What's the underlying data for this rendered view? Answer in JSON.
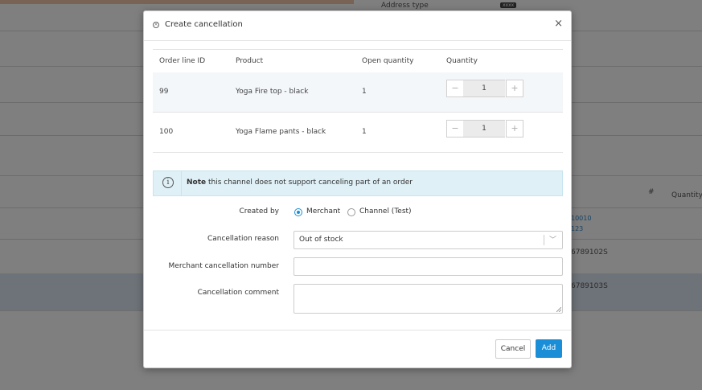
{
  "background": {
    "address_type_label": "Address type",
    "address_type_badge": "xxxx",
    "hash_header": "#",
    "quantity_header": "Quantity",
    "row1_link_a": "10010",
    "row1_link_b": "123",
    "row2_id": "6789102S",
    "row3_id": "6789103S"
  },
  "modal": {
    "title": "Create cancellation",
    "close": "×",
    "table": {
      "headers": [
        "Order line ID",
        "Product",
        "Open quantity",
        "Quantity"
      ],
      "rows": [
        {
          "id": "99",
          "product": "Yoga Fire top - black",
          "open_qty": "1",
          "qty": "1"
        },
        {
          "id": "100",
          "product": "Yoga Flame pants - black",
          "open_qty": "1",
          "qty": "1"
        }
      ],
      "minus": "−",
      "plus": "+"
    },
    "note": {
      "label": "Note",
      "text": " this channel does not support canceling part of an order"
    },
    "form": {
      "created_by_label": "Created by",
      "option_merchant": "Merchant",
      "option_channel": "Channel (Test)",
      "selected_option": "Merchant",
      "reason_label": "Cancellation reason",
      "reason_value": "Out of stock",
      "number_label": "Merchant cancellation number",
      "number_value": "",
      "comment_label": "Cancellation comment",
      "comment_value": ""
    },
    "footer": {
      "cancel": "Cancel",
      "add": "Add"
    }
  },
  "colors": {
    "accent": "#1a8fd8",
    "note_bg": "#dff0f7",
    "overlay": "rgba(0,0,0,0.5)"
  }
}
